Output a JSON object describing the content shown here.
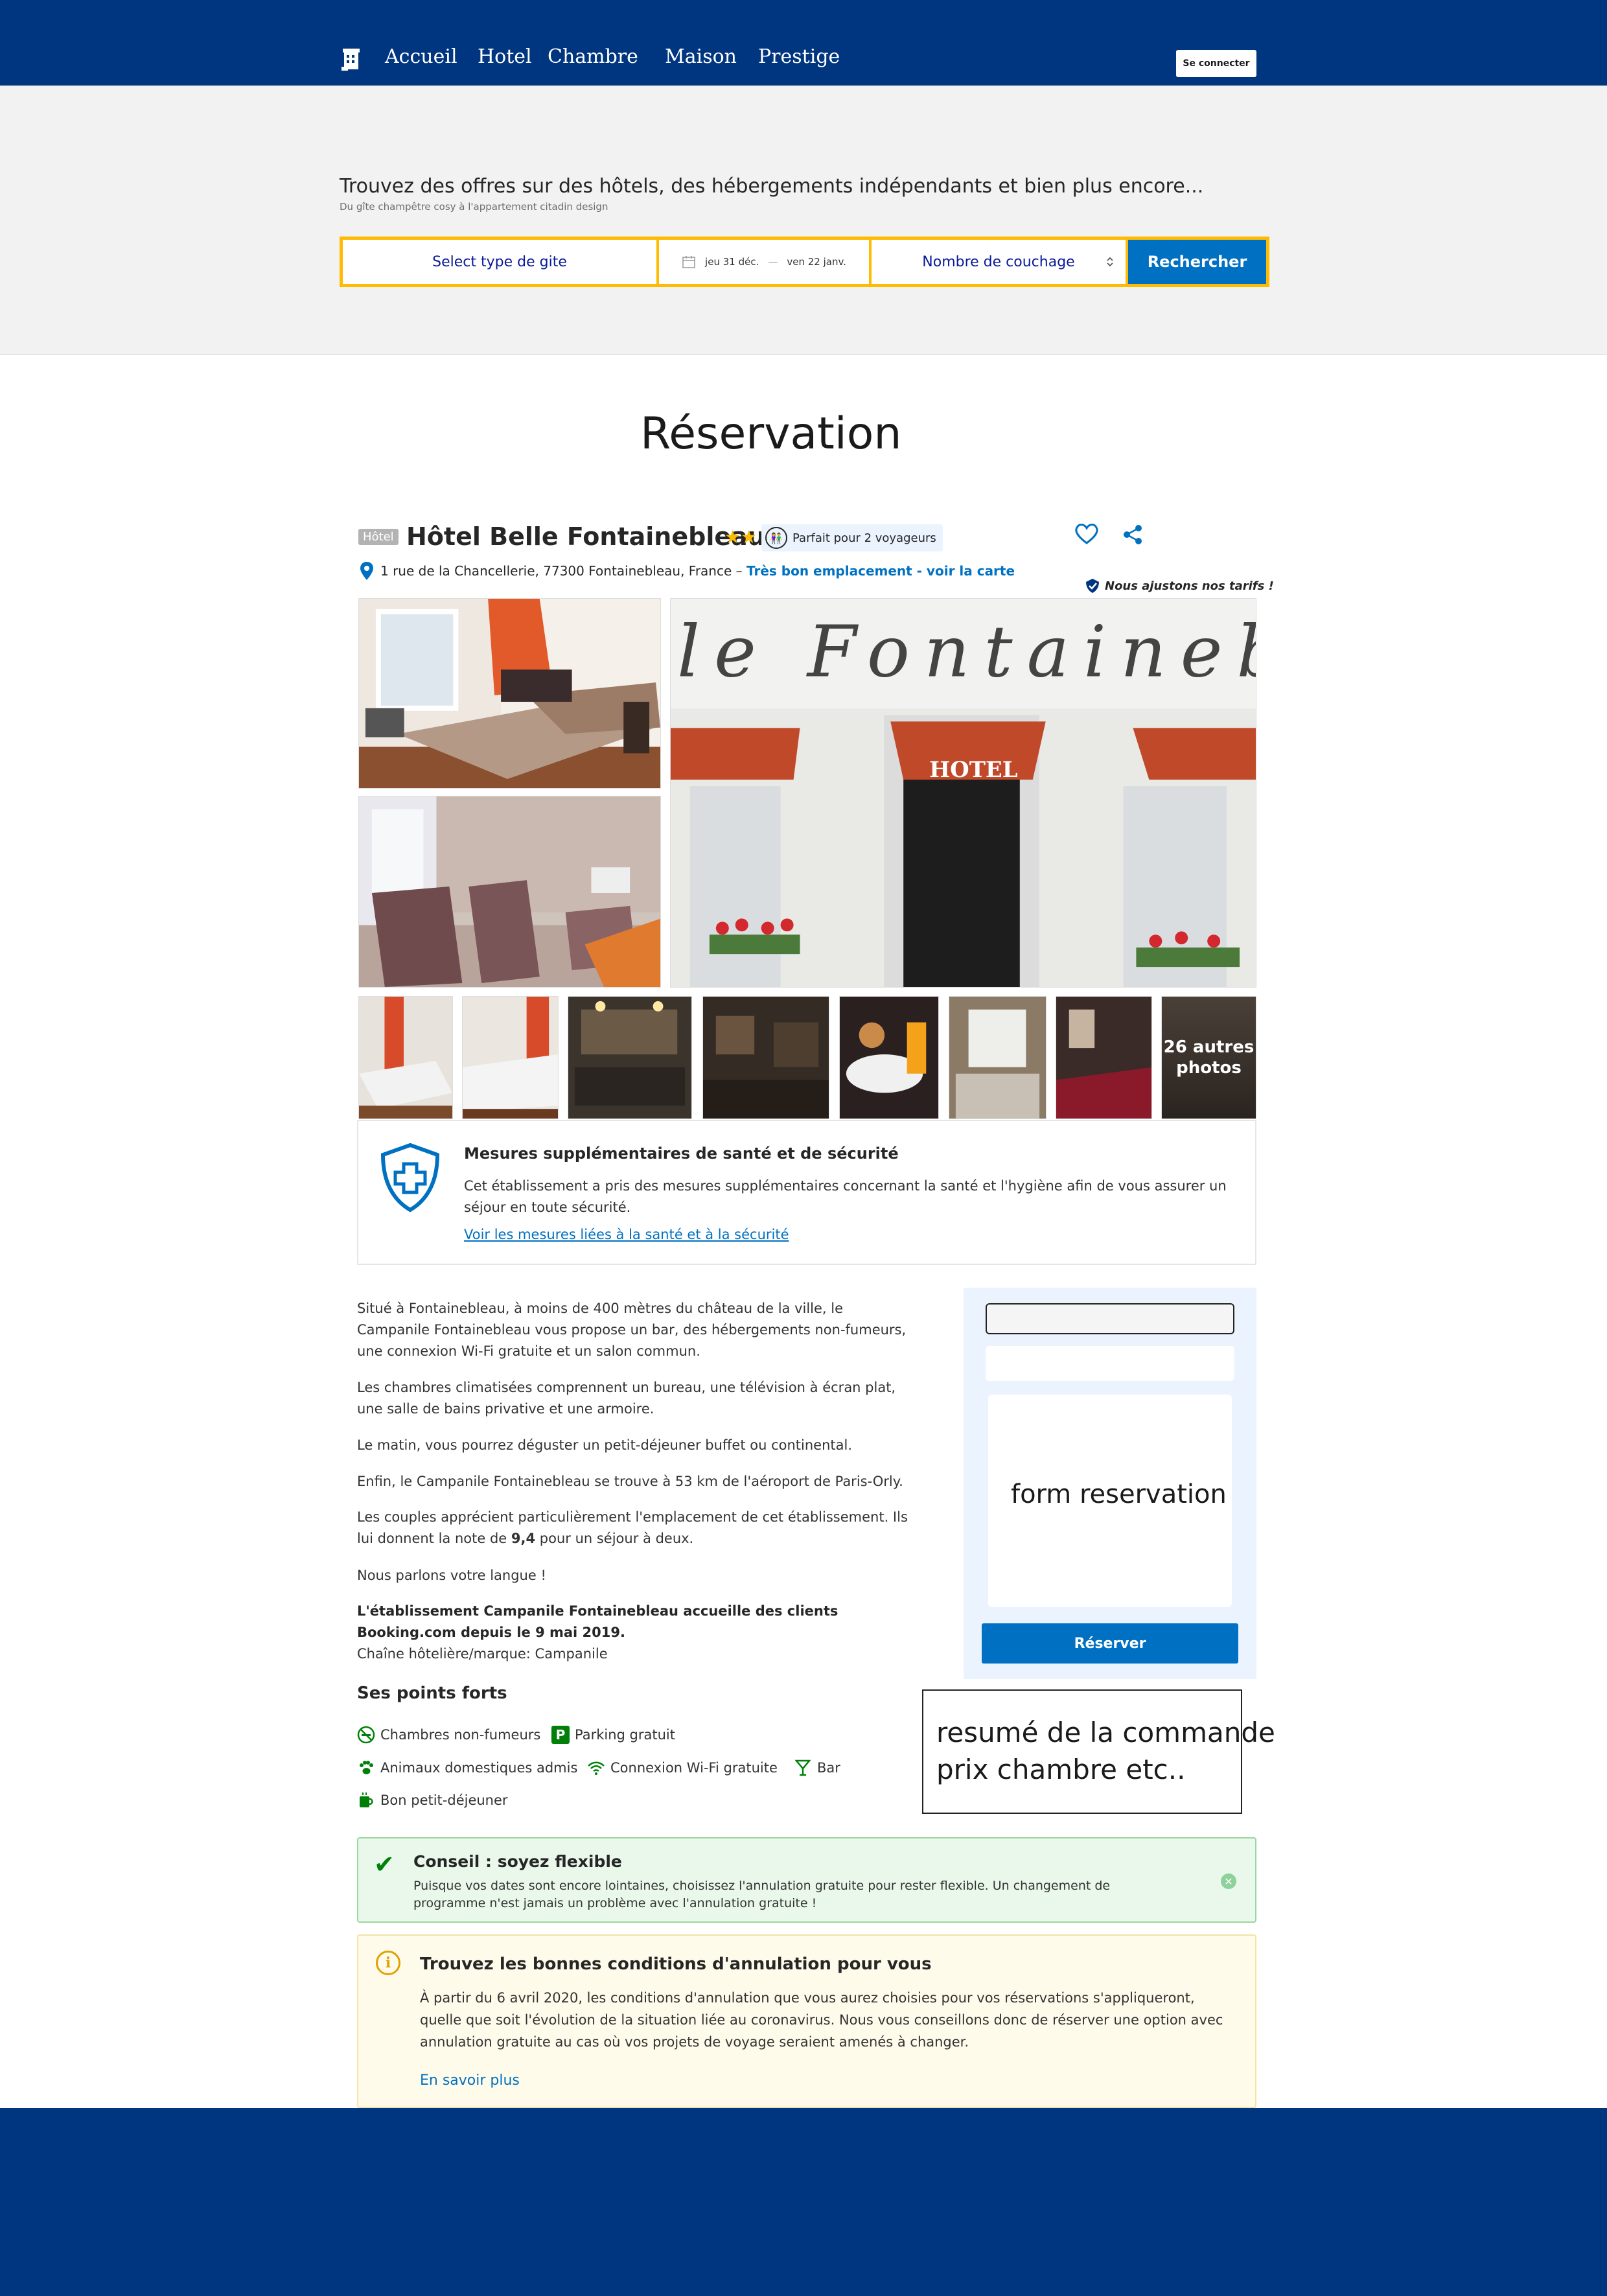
{
  "nav": {
    "items": [
      "Accueil",
      "Hotel",
      "Chambre",
      "Maison",
      "Prestige"
    ],
    "login": "Se connecter"
  },
  "hero": {
    "title": "Trouvez des offres sur des hôtels, des hébergements indépendants et bien plus encore...",
    "subtitle": "Du gîte champêtre cosy à l'appartement citadin design"
  },
  "search": {
    "type_placeholder": "Select type de gite",
    "date_start": "jeu 31 déc.",
    "date_sep": "—",
    "date_end": "ven 22 janv.",
    "sleep_placeholder": "Nombre de couchage",
    "button": "Rechercher"
  },
  "page_title": "Réservation",
  "hotel": {
    "badge": "Hôtel",
    "name": "Hôtel Belle Fontainebleau",
    "stars": 2,
    "stars_glyph": "★★",
    "fit": "Parfait pour 2 voyageurs",
    "address": "1 rue de la Chancellerie, 77300 Fontainebleau, France –",
    "location_link": "Très bon emplacement - voir la carte",
    "price_note": "Nous ajustons nos tarifs !",
    "more_photos": "26 autres photos"
  },
  "health": {
    "title": "Mesures supplémentaires de santé et de sécurité",
    "text": "Cet établissement a pris des mesures supplémentaires concernant la santé et l'hygiène afin de vous assurer un séjour en toute sécurité.",
    "link": "Voir les mesures liées à la santé et à la sécurité"
  },
  "description": {
    "p1": "Situé à Fontainebleau, à moins de 400 mètres du château de la ville, le Campanile Fontainebleau vous propose un bar, des hébergements non-fumeurs, une connexion Wi-Fi gratuite et un salon commun.",
    "p2": "Les chambres climatisées comprennent un bureau, une télévision à écran plat, une salle de bains privative et une armoire.",
    "p3": "Le matin, vous pourrez déguster un petit-déjeuner buffet ou continental.",
    "p4": "Enfin, le Campanile Fontainebleau se trouve à 53 km de l'aéroport de Paris-Orly.",
    "p5a": "Les couples apprécient particulièrement l'emplacement de cet établissement. Ils lui donnent la note de ",
    "p5_score": "9,4",
    "p5b": " pour un séjour à deux.",
    "p6": "Nous parlons votre langue !",
    "p7_bold": "L'établissement Campanile Fontainebleau accueille des clients Booking.com depuis le 9 mai 2019.",
    "p7_chain": "Chaîne hôtelière/marque: Campanile"
  },
  "form": {
    "label": "form reservation",
    "button": "Réserver"
  },
  "summary": {
    "line1": "resumé de la commande",
    "line2": "prix chambre etc.."
  },
  "highlights": {
    "title": "Ses points forts",
    "items": [
      "Chambres non-fumeurs",
      "Parking gratuit",
      "Animaux domestiques admis",
      "Connexion Wi-Fi gratuite",
      "Bar",
      "Bon petit-déjeuner"
    ]
  },
  "tip": {
    "title": "Conseil : soyez flexible",
    "text": "Puisque vos dates sont encore lointaines, choisissez l'annulation gratuite pour rester flexible. Un changement de programme n'est jamais un problème avec l'annulation gratuite !"
  },
  "cancellation": {
    "title": "Trouvez les bonnes conditions d'annulation pour vous",
    "text": "À partir du 6 avril 2020, les conditions d'annulation que vous aurez choisies pour vos réservations s'appliqueront, quelle que soit l'évolution de la situation liée au coronavirus. Nous vous conseillons donc de réserver une option avec annulation gratuite au cas où vos projets de voyage seraient amenés à changer.",
    "link": "En savoir plus"
  },
  "colors": {
    "brand": "#003580",
    "accent": "#0071c2",
    "search_border": "#febb02",
    "star": "#febb02",
    "success": "#008009"
  }
}
